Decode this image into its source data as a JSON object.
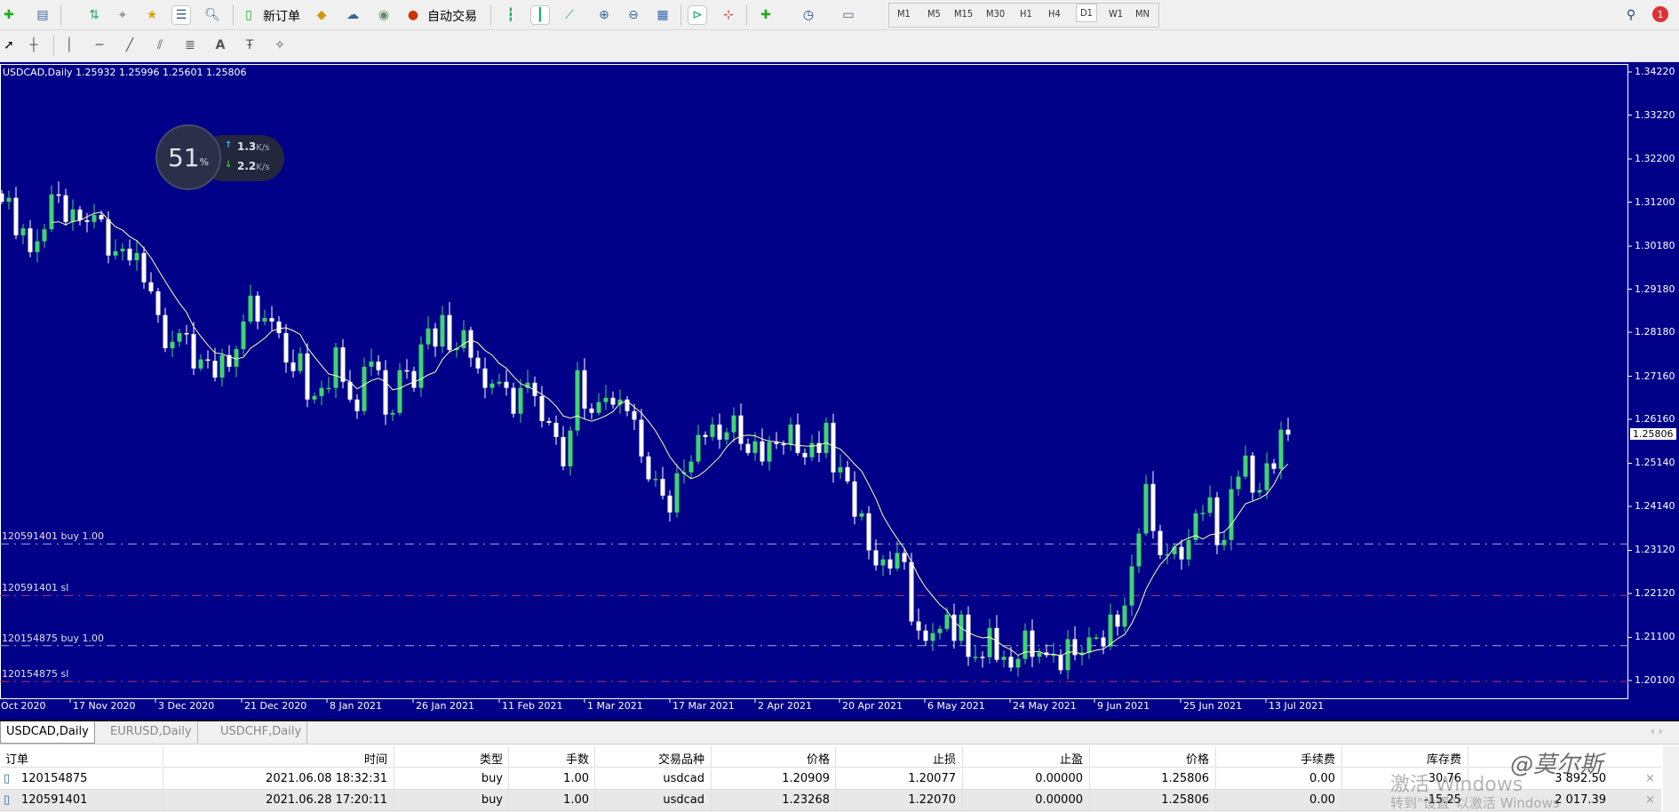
{
  "toolbar": {
    "new_order_label": "新订单",
    "auto_trading_label": "自动交易",
    "timeframes": [
      "M1",
      "M5",
      "M15",
      "M30",
      "H1",
      "H4",
      "D1",
      "W1",
      "MN"
    ],
    "active_timeframe": "D1",
    "notification_count": "1"
  },
  "chart": {
    "title": "USDCAD,Daily  1.25932 1.25996 1.25601 1.25806",
    "current_price": "1.25806",
    "price_labels": [
      "1.34220",
      "1.33220",
      "1.32200",
      "1.31200",
      "1.30180",
      "1.29180",
      "1.28180",
      "1.27160",
      "1.26160",
      "1.25140",
      "1.24140",
      "1.23120",
      "1.22120",
      "1.21100",
      "1.20100"
    ],
    "date_labels": [
      "Oct 2020",
      "17 Nov 2020",
      "3 Dec 2020",
      "21 Dec 2020",
      "8 Jan 2021",
      "26 Jan 2021",
      "11 Feb 2021",
      "1 Mar 2021",
      "17 Mar 2021",
      "2 Apr 2021",
      "20 Apr 2021",
      "6 May 2021",
      "24 May 2021",
      "9 Jun 2021",
      "25 Jun 2021",
      "13 Jul 2021"
    ],
    "order_lines": [
      {
        "label": "120591401 buy 1.00",
        "price": 1.23268,
        "kind": "entry"
      },
      {
        "label": "120591401 sl",
        "price": 1.2207,
        "kind": "sl"
      },
      {
        "label": "120154875 buy 1.00",
        "price": 1.20909,
        "kind": "entry"
      },
      {
        "label": "120154875 sl",
        "price": 1.20077,
        "kind": "sl"
      }
    ],
    "colors": {
      "background": "#000088",
      "bull": "#3fd470",
      "bear": "#ffffff",
      "ma": "#ffffb0",
      "entry_line": "#9fb0d0",
      "sl_line": "#c0305a"
    }
  },
  "speed_widget": {
    "percent": "51",
    "percent_sign": "%",
    "upload": "1.3",
    "download": "2.2",
    "unit": "K/s"
  },
  "chart_data": {
    "type": "candlestick",
    "symbol": "USDCAD",
    "timeframe": "Daily",
    "ylim": [
      1.201,
      1.3422
    ],
    "ma_period": 8,
    "first_open": 1.314,
    "closes": [
      1.3121,
      1.313,
      1.3043,
      1.3059,
      1.3004,
      1.3029,
      1.3057,
      1.3138,
      1.3136,
      1.3074,
      1.3103,
      1.3078,
      1.3074,
      1.309,
      1.308,
      1.2996,
      1.3006,
      1.3012,
      1.2985,
      1.3002,
      1.2934,
      1.2913,
      1.2858,
      1.2781,
      1.2796,
      1.2816,
      1.2814,
      1.2734,
      1.2755,
      1.2752,
      1.2713,
      1.2765,
      1.2738,
      1.2779,
      1.2843,
      1.2903,
      1.2843,
      1.2851,
      1.2843,
      1.2816,
      1.2748,
      1.2728,
      1.2769,
      1.2662,
      1.267,
      1.2689,
      1.2689,
      1.2783,
      1.2703,
      1.2662,
      1.2635,
      1.2738,
      1.275,
      1.273,
      1.2627,
      1.2631,
      1.273,
      1.2728,
      1.2689,
      1.279,
      1.2827,
      1.2785,
      1.2858,
      1.2777,
      1.2781,
      1.2823,
      1.2759,
      1.2734,
      1.2689,
      1.2699,
      1.2703,
      1.2689,
      1.2629,
      1.2689,
      1.2701,
      1.267,
      1.2612,
      1.2608,
      1.2575,
      1.2507,
      1.259,
      1.273,
      1.2641,
      1.2631,
      1.2656,
      1.2666,
      1.265,
      1.2662,
      1.2635,
      1.2615,
      1.253,
      1.2477,
      1.2478,
      1.2439,
      1.24,
      1.2491,
      1.2493,
      1.2518,
      1.258,
      1.2575,
      1.2604,
      1.2569,
      1.2586,
      1.2625,
      1.2559,
      1.2538,
      1.2565,
      1.2518,
      1.2563,
      1.2559,
      1.2558,
      1.2604,
      1.2538,
      1.2528,
      1.2561,
      1.2538,
      1.2608,
      1.2493,
      1.2505,
      1.2472,
      1.239,
      1.2398,
      1.2312,
      1.2277,
      1.2291,
      1.227,
      1.2306,
      1.2285,
      1.2147,
      1.2126,
      1.2102,
      1.212,
      1.213,
      1.2163,
      1.2102,
      1.2163,
      1.2065,
      1.2065,
      1.2064,
      1.2132,
      1.2058,
      1.2065,
      1.204,
      1.206,
      1.2126,
      1.2065,
      1.2075,
      1.2069,
      1.207,
      1.2034,
      1.2106,
      1.2069,
      1.2075,
      1.211,
      1.211,
      1.2089,
      1.2163,
      1.2135,
      1.2184,
      1.2275,
      1.2351,
      1.2466,
      1.2357,
      1.2301,
      1.2303,
      1.232,
      1.2291,
      1.2336,
      1.2398,
      1.2399,
      1.2435,
      1.2324,
      1.2336,
      1.2454,
      1.2483,
      1.2532,
      1.2446,
      1.2452,
      1.2514,
      1.2501,
      1.2592,
      1.25806
    ]
  },
  "tabs": [
    "USDCAD,Daily",
    "EURUSD,Daily",
    "USDCHF,Daily"
  ],
  "terminal": {
    "columns": [
      "订单",
      "时间",
      "类型",
      "手数",
      "交易品种",
      "价格",
      "止损",
      "止盈",
      "价格",
      "手续费",
      "库存费"
    ],
    "rows": [
      [
        "120154875",
        "2021.06.08 18:32:31",
        "buy",
        "1.00",
        "usdcad",
        "1.20909",
        "1.20077",
        "0.00000",
        "1.25806",
        "0.00",
        "30.76",
        "3 892.50"
      ],
      [
        "120591401",
        "2021.06.28 17:20:11",
        "buy",
        "1.00",
        "usdcad",
        "1.23268",
        "1.22070",
        "0.00000",
        "1.25806",
        "0.00",
        "-15.25",
        "2 017.39"
      ]
    ]
  },
  "watermark": {
    "line1": "激活 Windows",
    "line2": "转到\"设置\"以激活 Windows",
    "logo": "@莫尔斯"
  }
}
